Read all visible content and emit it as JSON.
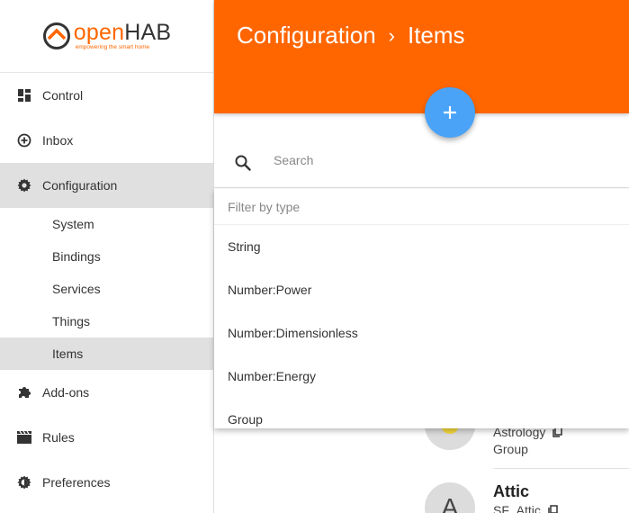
{
  "app": {
    "logo_text_orange": "open",
    "logo_text_dark": "HAB",
    "logo_tagline": "empowering the smart home"
  },
  "sidebar": {
    "items": [
      {
        "label": "Control",
        "icon": "dashboard-icon"
      },
      {
        "label": "Inbox",
        "icon": "add-circle-icon"
      },
      {
        "label": "Configuration",
        "icon": "gear-icon",
        "active": true
      },
      {
        "label": "Add-ons",
        "icon": "puzzle-icon"
      },
      {
        "label": "Rules",
        "icon": "clapperboard-icon"
      },
      {
        "label": "Preferences",
        "icon": "settings-outline-icon"
      }
    ],
    "subitems": [
      {
        "label": "System"
      },
      {
        "label": "Bindings"
      },
      {
        "label": "Services"
      },
      {
        "label": "Things"
      },
      {
        "label": "Items",
        "active": true
      }
    ]
  },
  "header": {
    "crumb_1": "Configuration",
    "separator": "›",
    "crumb_2": "Items"
  },
  "search": {
    "placeholder": "Search"
  },
  "filter": {
    "placeholder": "Filter by type",
    "options": [
      "String",
      "Number:Power",
      "Number:Dimensionless",
      "Number:Energy",
      "Group"
    ]
  },
  "items": [
    {
      "name": "",
      "label": "Astrology",
      "type": "Group",
      "avatar": ""
    },
    {
      "name": "Attic",
      "label": "SF_Attic",
      "avatar": "A"
    }
  ],
  "colors": {
    "accent": "#ff6600",
    "fab": "#4aa3f7",
    "active_bg": "#e0e0e0",
    "sun": "#f5d93a"
  }
}
